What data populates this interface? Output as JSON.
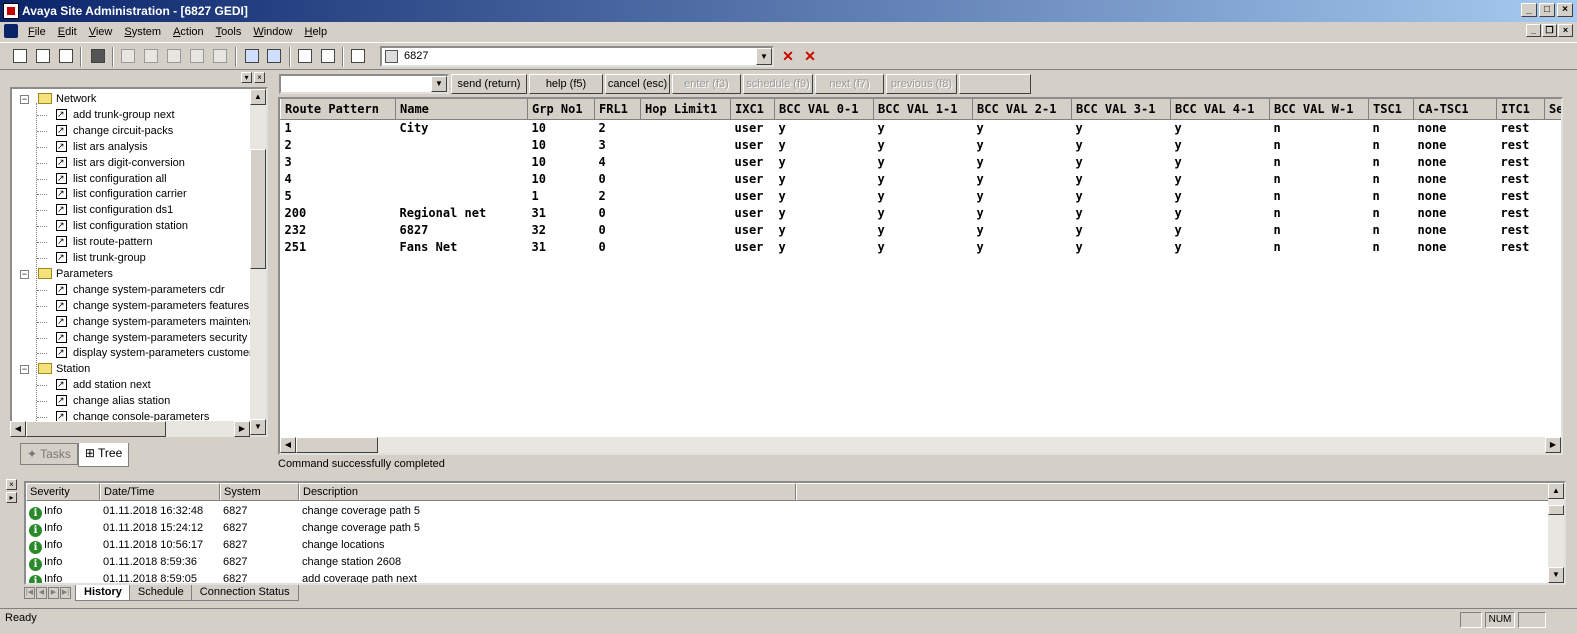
{
  "window": {
    "title": "Avaya Site Administration - [6827 GEDI]"
  },
  "menu": [
    "File",
    "Edit",
    "View",
    "System",
    "Action",
    "Tools",
    "Window",
    "Help"
  ],
  "toolbar": {
    "system_value": "6827"
  },
  "tree": {
    "items": [
      {
        "type": "folder",
        "label": "Network"
      },
      {
        "type": "cmd",
        "label": "add trunk-group next"
      },
      {
        "type": "cmd",
        "label": "change circuit-packs"
      },
      {
        "type": "cmd",
        "label": "list ars analysis"
      },
      {
        "type": "cmd",
        "label": "list ars digit-conversion"
      },
      {
        "type": "cmd",
        "label": "list configuration all"
      },
      {
        "type": "cmd",
        "label": "list configuration carrier"
      },
      {
        "type": "cmd",
        "label": "list configuration ds1"
      },
      {
        "type": "cmd",
        "label": "list configuration station"
      },
      {
        "type": "cmd",
        "label": "list route-pattern"
      },
      {
        "type": "cmd",
        "label": "list trunk-group"
      },
      {
        "type": "folder",
        "label": "Parameters"
      },
      {
        "type": "cmd",
        "label": "change system-parameters cdr"
      },
      {
        "type": "cmd",
        "label": "change system-parameters features"
      },
      {
        "type": "cmd",
        "label": "change system-parameters maintenance"
      },
      {
        "type": "cmd",
        "label": "change system-parameters security"
      },
      {
        "type": "cmd",
        "label": "display system-parameters customer"
      },
      {
        "type": "folder",
        "label": "Station"
      },
      {
        "type": "cmd",
        "label": "add station next"
      },
      {
        "type": "cmd",
        "label": "change alias station"
      },
      {
        "type": "cmd",
        "label": "change console-parameters"
      }
    ],
    "tabs": {
      "tasks": "Tasks",
      "tree": "Tree"
    }
  },
  "fkeys": [
    {
      "label": "send (return)",
      "enabled": true
    },
    {
      "label": "help (f5)",
      "enabled": true
    },
    {
      "label": "cancel (esc)",
      "enabled": true
    },
    {
      "label": "enter (f3)",
      "enabled": false
    },
    {
      "label": "schedule (f9)",
      "enabled": false
    },
    {
      "label": "next (f7)",
      "enabled": false
    },
    {
      "label": "previous (f8)",
      "enabled": false
    },
    {
      "label": "",
      "enabled": false
    }
  ],
  "grid": {
    "columns": [
      "Route Pattern",
      "Name",
      "Grp No1",
      "FRL1",
      "Hop Limit1",
      "IXC1",
      "BCC VAL 0-1",
      "BCC VAL 1-1",
      "BCC VAL 2-1",
      "BCC VAL 3-1",
      "BCC VAL 4-1",
      "BCC VAL W-1",
      "TSC1",
      "CA-TSC1",
      "ITC1",
      "Se"
    ],
    "rows": [
      [
        "1",
        "City",
        "10",
        "2",
        "",
        "user",
        "y",
        "y",
        "y",
        "y",
        "y",
        "n",
        "n",
        "none",
        "rest",
        ""
      ],
      [
        "2",
        "",
        "10",
        "3",
        "",
        "user",
        "y",
        "y",
        "y",
        "y",
        "y",
        "n",
        "n",
        "none",
        "rest",
        ""
      ],
      [
        "3",
        "",
        "10",
        "4",
        "",
        "user",
        "y",
        "y",
        "y",
        "y",
        "y",
        "n",
        "n",
        "none",
        "rest",
        ""
      ],
      [
        "4",
        "",
        "10",
        "0",
        "",
        "user",
        "y",
        "y",
        "y",
        "y",
        "y",
        "n",
        "n",
        "none",
        "rest",
        ""
      ],
      [
        "5",
        "",
        "1",
        "2",
        "",
        "user",
        "y",
        "y",
        "y",
        "y",
        "y",
        "n",
        "n",
        "none",
        "rest",
        ""
      ],
      [
        "200",
        "Regional net",
        "31",
        "0",
        "",
        "user",
        "y",
        "y",
        "y",
        "y",
        "y",
        "n",
        "n",
        "none",
        "rest",
        ""
      ],
      [
        "232",
        "6827",
        "32",
        "0",
        "",
        "user",
        "y",
        "y",
        "y",
        "y",
        "y",
        "n",
        "n",
        "none",
        "rest",
        ""
      ],
      [
        "251",
        "Fans Net",
        "31",
        "0",
        "",
        "user",
        "y",
        "y",
        "y",
        "y",
        "y",
        "n",
        "n",
        "none",
        "rest",
        ""
      ]
    ]
  },
  "status_message": "Command successfully completed",
  "log": {
    "columns": [
      "Severity",
      "Date/Time",
      "System",
      "Description"
    ],
    "rows": [
      [
        "Info",
        "01.11.2018 16:32:48",
        "6827",
        "change coverage path 5"
      ],
      [
        "Info",
        "01.11.2018 15:24:12",
        "6827",
        "change coverage path 5"
      ],
      [
        "Info",
        "01.11.2018 10:56:17",
        "6827",
        "change locations"
      ],
      [
        "Info",
        "01.11.2018 8:59:36",
        "6827",
        "change station 2608"
      ],
      [
        "Info",
        "01.11.2018 8:59:05",
        "6827",
        "add coverage path next"
      ]
    ],
    "tabs": [
      "History",
      "Schedule",
      "Connection Status"
    ]
  },
  "statusbar": {
    "text": "Ready",
    "num": "NUM"
  }
}
